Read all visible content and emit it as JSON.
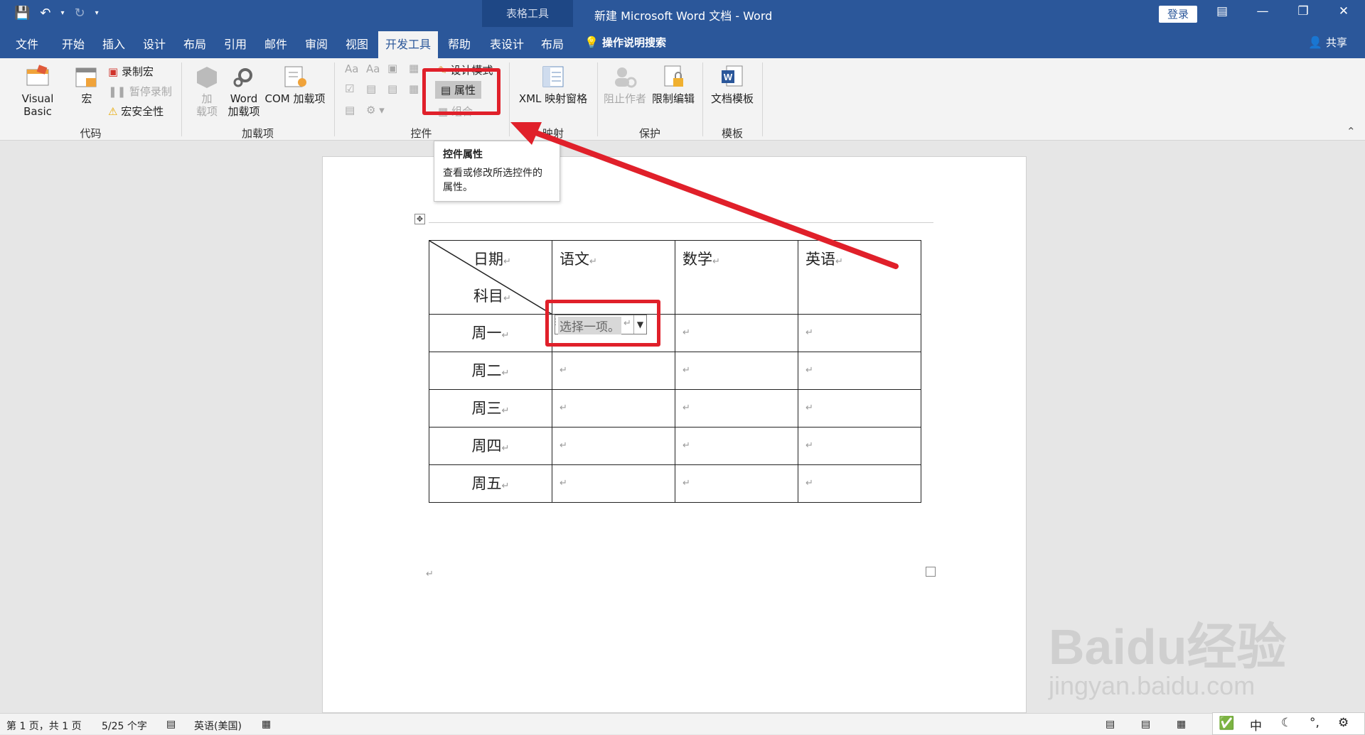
{
  "titlebar": {
    "context_tab": "表格工具",
    "document_title": "新建 Microsoft Word 文档  -  Word",
    "login_label": "登录"
  },
  "tabs": [
    "文件",
    "开始",
    "插入",
    "设计",
    "布局",
    "引用",
    "邮件",
    "审阅",
    "视图",
    "开发工具",
    "帮助",
    "表设计",
    "布局"
  ],
  "active_tab": "开发工具",
  "tell_me": "操作说明搜索",
  "share_label": "共享",
  "ribbon": {
    "code": {
      "label": "代码",
      "visual_basic": "Visual Basic",
      "macros": "宏",
      "record_macro": "录制宏",
      "pause_recording": "暂停录制",
      "macro_security": "宏安全性"
    },
    "addins": {
      "label": "加载项",
      "addins_line1": "加",
      "addins_line2": "载项",
      "word_addins_line1": "Word",
      "word_addins_line2": "加载项",
      "com_addins": "COM 加载项"
    },
    "controls": {
      "label": "控件",
      "design_mode": "设计模式",
      "properties": "属性",
      "group": "组合"
    },
    "mapping": {
      "label": "映射",
      "xml_pane": "XML 映射窗格"
    },
    "protect": {
      "label": "保护",
      "block_authors": "阻止作者",
      "restrict_editing": "限制编辑"
    },
    "templates": {
      "label": "模板",
      "document_template": "文档模板"
    }
  },
  "tooltip": {
    "title": "控件属性",
    "body": "查看或修改所选控件的属性。"
  },
  "table": {
    "header_top": "日期",
    "header_bottom": "科目",
    "columns": [
      "语文",
      "数学",
      "英语"
    ],
    "rows": [
      "周一",
      "周二",
      "周三",
      "周四",
      "周五"
    ],
    "dropdown_placeholder": "选择一项。"
  },
  "status": {
    "page": "第 1 页，共 1 页",
    "words": "5/25 个字",
    "language": "英语(美国)"
  },
  "watermark": {
    "brand": "Baidu经验",
    "url": "jingyan.baidu.com"
  },
  "ime": {
    "mode": "中"
  },
  "colors": {
    "accent": "#2b579a",
    "highlight": "#e0202a"
  }
}
